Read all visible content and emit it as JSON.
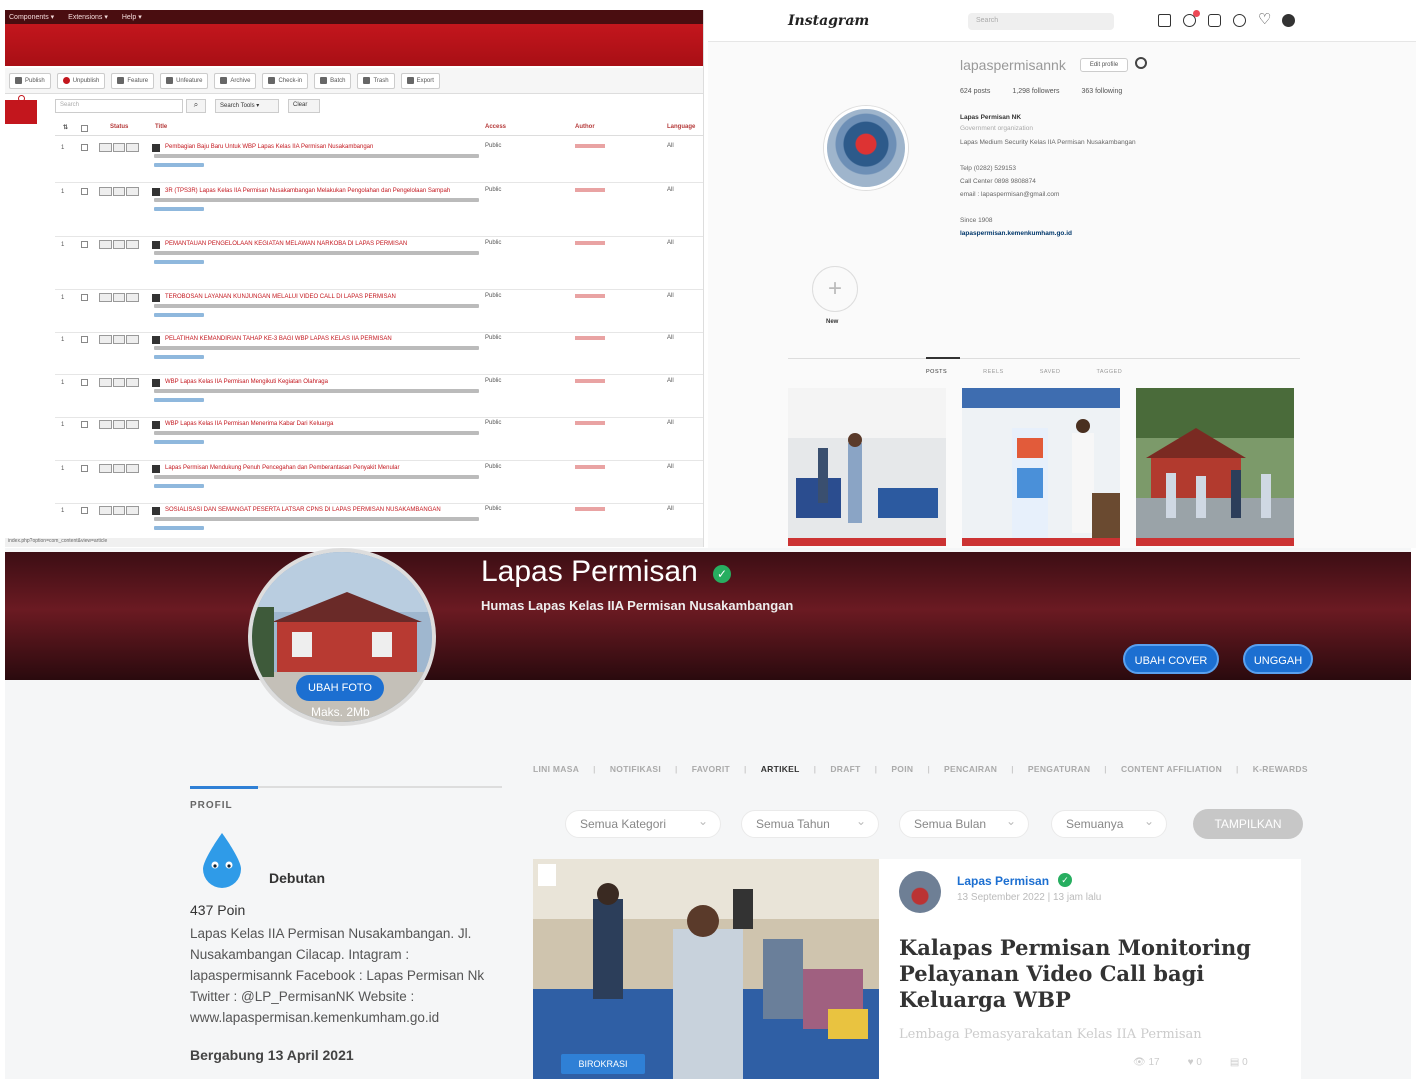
{
  "cms": {
    "menu": [
      "Components ▾",
      "Extensions ▾",
      "Help ▾"
    ],
    "toolbar": [
      "Publish",
      "Unpublish",
      "Feature",
      "Unfeature",
      "Archive",
      "Check-in",
      "Batch",
      "Trash",
      "Export"
    ],
    "search_placeholder": "Search",
    "search_tools": "Search Tools ▾",
    "clear": "Clear",
    "columns": [
      "Status",
      "Title",
      "Access",
      "Author",
      "Language"
    ],
    "rows": [
      {
        "title": "Pembagian Baju Baru Untuk WBP Lapas Kelas IIA Permisan Nusakambangan",
        "access": "Public",
        "lang": "All"
      },
      {
        "title": "3R (TPS3R) Lapas Kelas IIA Permisan Nusakambangan Melakukan Pengolahan dan Pengelolaan Sampah",
        "access": "Public",
        "lang": "All"
      },
      {
        "title": "PEMANTAUAN PENGELOLAAN KEGIATAN MELAWAN NARKOBA DI LAPAS PERMISAN",
        "access": "Public",
        "lang": "All"
      },
      {
        "title": "TEROBOSAN LAYANAN KUNJUNGAN MELALUI VIDEO CALL DI LAPAS PERMISAN",
        "access": "Public",
        "lang": "All"
      },
      {
        "title": "PELATIHAN KEMANDIRIAN TAHAP KE-3 BAGI WBP LAPAS KELAS IIA PERMISAN",
        "access": "Public",
        "lang": "All"
      },
      {
        "title": "WBP Lapas Kelas IIA Permisan Mengikuti Kegiatan Olahraga",
        "access": "Public",
        "lang": "All"
      },
      {
        "title": "WBP Lapas Kelas IIA Permisan Menerima Kabar Dari Keluarga",
        "access": "Public",
        "lang": "All"
      },
      {
        "title": "Lapas Permisan Mendukung Penuh Pencegahan dan Pemberantasan Penyakit Menular",
        "access": "Public",
        "lang": "All"
      },
      {
        "title": "SOSIALISASI DAN SEMANGAT PESERTA LATSAR CPNS DI LAPAS PERMISAN NUSAKAMBANGAN",
        "access": "Public",
        "lang": "All"
      }
    ],
    "status_bar": "index.php?option=com_content&view=article"
  },
  "instagram": {
    "logo": "Instagram",
    "search": "Search",
    "username": "lapaspermisannk",
    "edit_profile": "Edit profile",
    "stats": [
      "624 posts",
      "1,298 followers",
      "363 following"
    ],
    "bio_name": "Lapas Permisan NK",
    "bio_category": "Government organization",
    "bio_lines": [
      "Lapas Medium Security Kelas IIA Permisan Nusakambangan",
      "Telp (0282) 529153",
      "Call Center 0898 9808874",
      "email : lapaspermisan@gmail.com",
      "Since 1908"
    ],
    "bio_link": "lapaspermisan.kemenkumham.go.id",
    "new_label": "New",
    "tabs": [
      "POSTS",
      "REELS",
      "SAVED",
      "TAGGED"
    ]
  },
  "kompasiana": {
    "name": "Lapas Permisan",
    "tagline": "Humas Lapas Kelas IIA Permisan Nusakambangan",
    "ubah_foto": "UBAH FOTO",
    "maks": "Maks. 2Mb",
    "ubah_cover": "UBAH COVER",
    "unggah": "UNGGAH",
    "tabs": [
      "LINI MASA",
      "NOTIFIKASI",
      "FAVORIT",
      "ARTIKEL",
      "DRAFT",
      "POIN",
      "PENCAIRAN",
      "PENGATURAN",
      "CONTENT AFFILIATION",
      "K-REWARDS"
    ],
    "active_tab": "ARTIKEL",
    "profile_label": "PROFIL",
    "rank": "Debutan",
    "poin": "437 Poin",
    "bio": "Lapas Kelas IIA Permisan Nusakambangan. Jl. Nusakambangan Cilacap. Intagram : lapaspermisannk Facebook : Lapas Permisan Nk Twitter : @LP_PermisanNK Website : www.lapaspermisan.kemenkumham.go.id",
    "joined": "Bergabung 13 April 2021",
    "filters": [
      "Semua Kategori",
      "Semua Tahun",
      "Semua Bulan",
      "Semuanya"
    ],
    "tampilkan": "TAMPILKAN",
    "article": {
      "author": "Lapas Permisan",
      "date": "13 September 2022 | 13 jam lalu",
      "title": "Kalapas Permisan Monitoring Pelayanan Video Call bagi Keluarga WBP",
      "desc": "Lembaga Pemasyarakatan Kelas IIA Permisan",
      "badge": "BIROKRASI",
      "views": "17",
      "likes": "0",
      "comments": "0"
    }
  }
}
